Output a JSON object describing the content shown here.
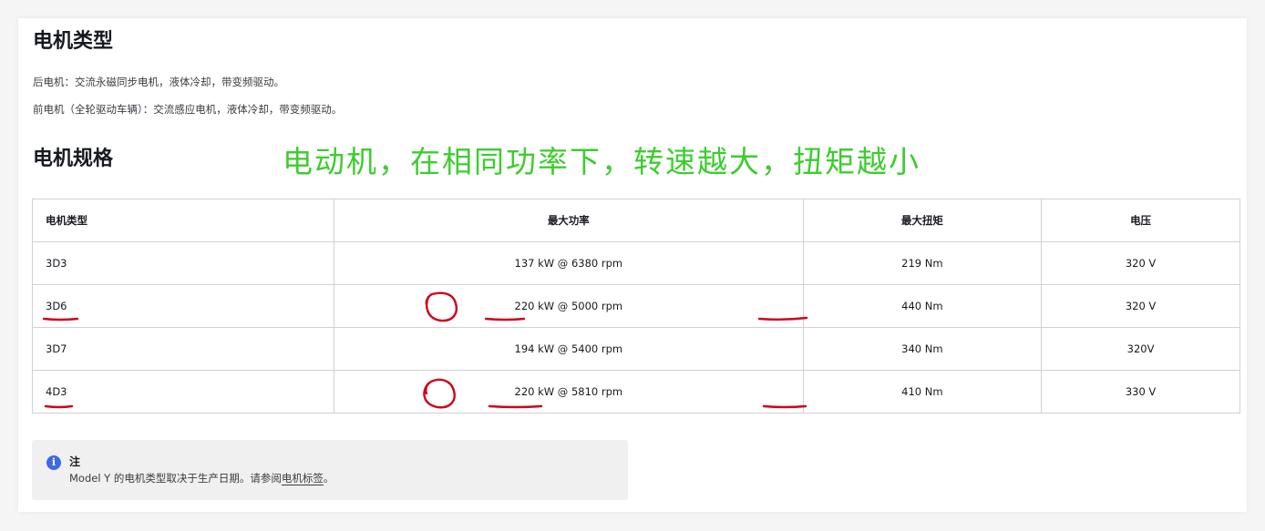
{
  "motor_type": {
    "title": "电机类型",
    "rear": "后电机：交流永磁同步电机，液体冷却，带变频驱动。",
    "front": "前电机（全轮驱动车辆）：交流感应电机，液体冷却，带变频驱动。"
  },
  "motor_specs": {
    "title": "电机规格",
    "annotation": "电动机，在相同功率下，转速越大，扭矩越小",
    "headers": [
      "电机类型",
      "最大功率",
      "最大扭矩",
      "电压"
    ],
    "rows": [
      [
        "3D3",
        "137 kW @ 6380 rpm",
        "219 Nm",
        "320 V"
      ],
      [
        "3D6",
        "220 kW @ 5000 rpm",
        "440 Nm",
        "320 V"
      ],
      [
        "3D7",
        "194 kW @ 5400 rpm",
        "340 Nm",
        "320V"
      ],
      [
        "4D3",
        "220 kW @ 5810 rpm",
        "410 Nm",
        "330 V"
      ]
    ]
  },
  "note": {
    "icon": "info-icon",
    "title": "注",
    "text_before": "Model Y 的电机类型取决于生产日期。请参阅",
    "link": "电机标签",
    "text_after": "。"
  },
  "colors": {
    "annotation_green": "#3ccd2e",
    "markup_red": "#d0021b",
    "info_blue": "#3e6ae1"
  }
}
